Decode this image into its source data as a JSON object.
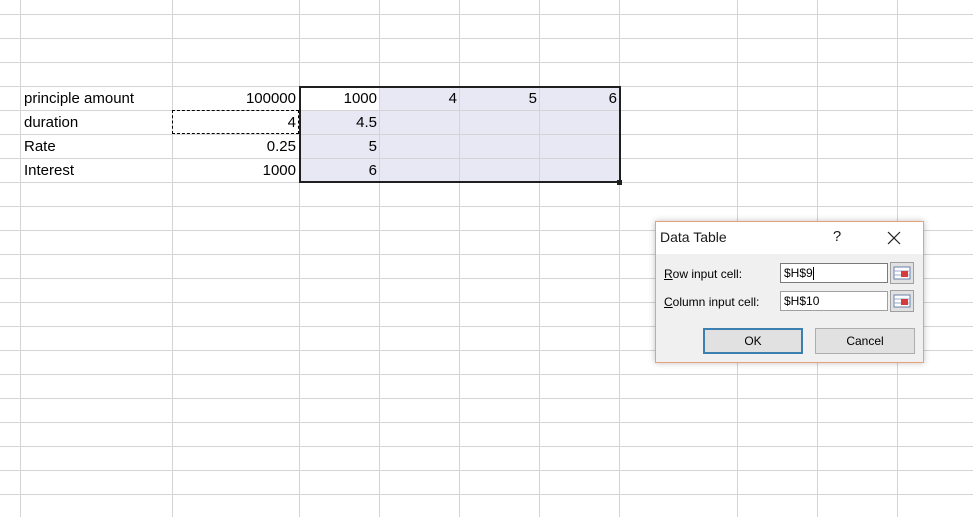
{
  "sheet": {
    "labels": [
      "principle amount",
      "duration",
      "Rate",
      "Interest"
    ],
    "values": [
      "100000",
      "4",
      "0.25",
      "1000"
    ],
    "table_corner": "1000",
    "row_inputs": [
      "4",
      "5",
      "6"
    ],
    "col_inputs": [
      "4.5",
      "5",
      "6"
    ]
  },
  "dialog": {
    "title": "Data Table",
    "help": "?",
    "row_label_accel": "R",
    "row_label_rest": "ow input cell:",
    "row_value": "$H$9",
    "col_label_accel": "C",
    "col_label_rest": "olumn input cell:",
    "col_value": "$H$10",
    "ok_label": "OK",
    "cancel_label": "Cancel"
  },
  "colors": {
    "selection_fill": "#e7e8f4",
    "gridline": "#d4d4d4",
    "dialog_border": "#e6a27a",
    "default_button_border": "#3c7fb1"
  },
  "icons": [
    "close-icon",
    "collapse-dialog-icon"
  ]
}
